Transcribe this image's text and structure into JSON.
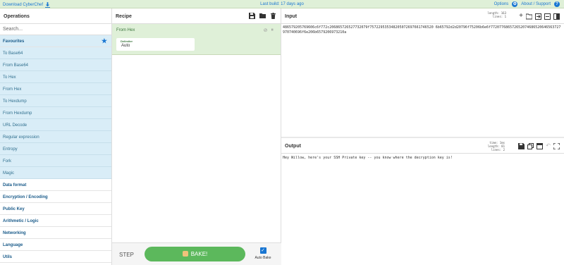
{
  "banner": {
    "download": "Download CyberChef",
    "last_build": "Last build: 17 days ago",
    "options": "Options",
    "about": "About / Support"
  },
  "operations": {
    "title": "Operations",
    "search_placeholder": "Search...",
    "favourites": "Favourites",
    "fav_items": [
      "To Base64",
      "From Base64",
      "To Hex",
      "From Hex",
      "To Hexdump",
      "From Hexdump",
      "URL Decode",
      "Regular expression",
      "Entropy",
      "Fork",
      "Magic"
    ],
    "categories": [
      "Data format",
      "Encryption / Encoding",
      "Public Key",
      "Arithmetic / Logic",
      "Networking",
      "Language",
      "Utils"
    ]
  },
  "recipe": {
    "title": "Recipe",
    "operation": {
      "name": "From Hex",
      "arg_label": "Delimiter",
      "arg_value": "Auto"
    },
    "step": "STEP",
    "bake": "BAKE!",
    "auto_bake": "Auto Bake"
  },
  "input": {
    "title": "Input",
    "length_label": "length:",
    "length_value": "163",
    "lines_label": "lines:",
    "lines_value": "1",
    "text": "486579205769606c6f772c206865726527732079f757229535348205072697661746520 6b65792d2d20796f75206b6e6f772077686572652074686520646563727970740696f6e206b6579206973210a"
  },
  "output": {
    "title": "Output",
    "time_label": "time:",
    "time_value": "1ms",
    "length_label": "length:",
    "length_value": "81",
    "lines_label": "lines:",
    "lines_value": "2",
    "text": "Hey Willow, here's your SSH Private key -- you know where the decryption key is!"
  },
  "colors": {
    "accent": "#1976d2",
    "banner_bg": "#dff0d8",
    "favourite_bg": "#d9edf7",
    "bake_button": "#5cb85c"
  }
}
